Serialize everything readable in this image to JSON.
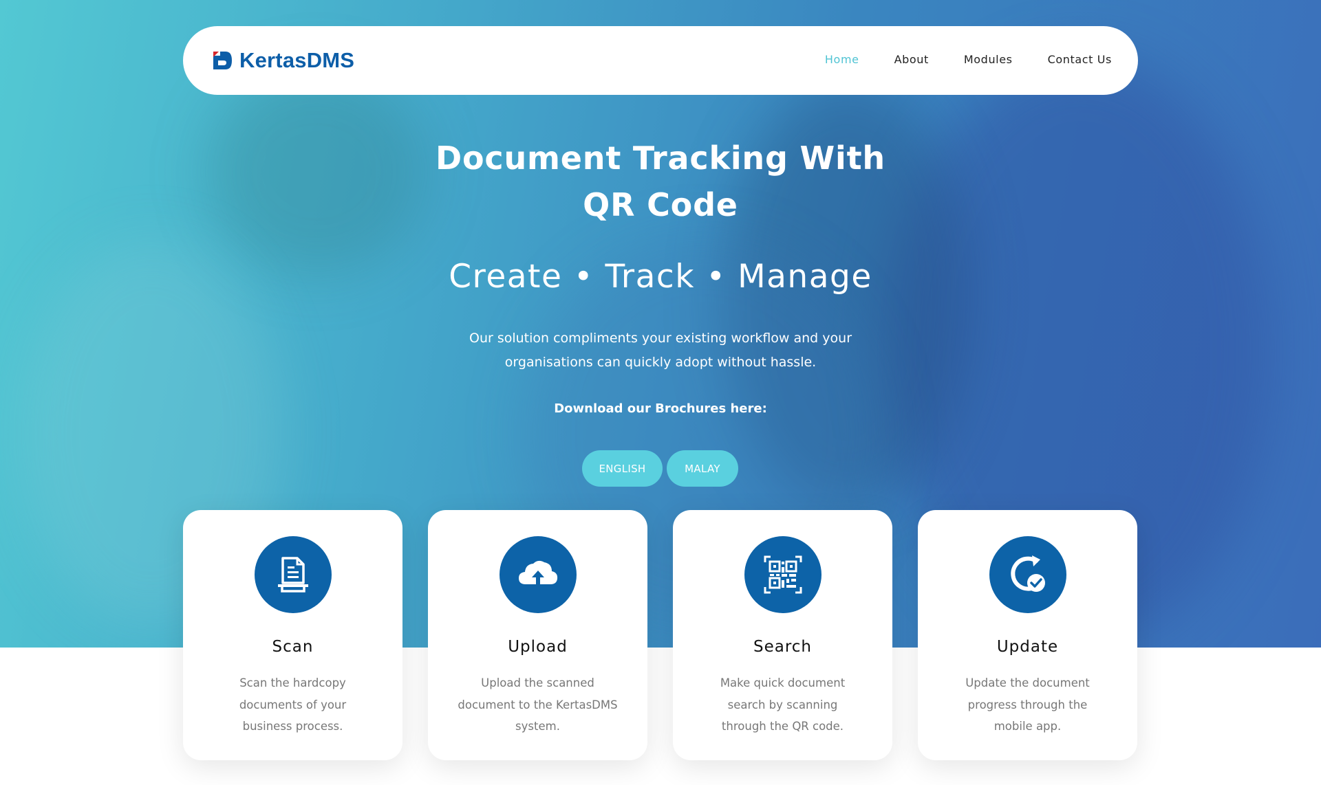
{
  "brand": {
    "name": "KertasDMS",
    "logo_colors": {
      "primary": "#0d5ea8",
      "accent": "#d7262b"
    }
  },
  "nav": {
    "items": [
      {
        "label": "Home",
        "active": true
      },
      {
        "label": "About",
        "active": false
      },
      {
        "label": "Modules",
        "active": false
      },
      {
        "label": "Contact Us",
        "active": false
      }
    ],
    "active_color": "#4fc3d3"
  },
  "hero": {
    "title_line1": "Document Tracking With",
    "title_line2": "QR Code",
    "subtitle": "Create • Track • Manage",
    "description_line1": "Our solution compliments your existing workflow and your",
    "description_line2": "organisations can quickly adopt without hassle.",
    "download_label": "Download our Brochures here:",
    "buttons": {
      "english": "ENGLISH",
      "malay": "MALAY"
    },
    "button_color": "#5ad0df"
  },
  "features": [
    {
      "title": "Scan",
      "icon": "scan-document-icon",
      "desc": [
        "Scan the hardcopy",
        "documents of your",
        "business process."
      ]
    },
    {
      "title": "Upload",
      "icon": "cloud-upload-icon",
      "desc": [
        "Upload the scanned",
        "document to the KertasDMS",
        "system."
      ]
    },
    {
      "title": "Search",
      "icon": "qr-code-icon",
      "desc": [
        "Make quick document",
        "search by scanning",
        "through the QR code."
      ]
    },
    {
      "title": "Update",
      "icon": "refresh-check-icon",
      "desc": [
        "Update the document",
        "progress through the",
        "mobile app."
      ]
    }
  ],
  "icon_circle_color": "#0d63a8"
}
